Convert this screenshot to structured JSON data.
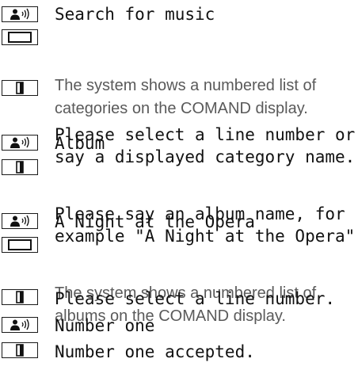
{
  "dialog": [
    {
      "kind": "user",
      "icon": "speaker-voice-icon",
      "lines": [
        "Search for music"
      ]
    },
    {
      "kind": "display",
      "icon": "display-screen-icon",
      "lines": [
        "The system shows a numbered list of",
        "categories on the COMAND display."
      ]
    },
    {
      "kind": "system",
      "icon": "loudspeaker-icon",
      "lines": [
        "Please select a line number or",
        "say a displayed category name."
      ]
    },
    {
      "kind": "user",
      "icon": "speaker-voice-icon",
      "lines": [
        "Album"
      ]
    },
    {
      "kind": "system",
      "icon": "loudspeaker-icon",
      "lines": [
        "Please say an album name, for",
        "example \"A Night at the Opera\"."
      ]
    },
    {
      "kind": "user",
      "icon": "speaker-voice-icon",
      "lines": [
        "A Night at the Opera"
      ]
    },
    {
      "kind": "display",
      "icon": "display-screen-icon",
      "lines": [
        "The system shows a numbered list of",
        "albums on the COMAND display."
      ]
    },
    {
      "kind": "system",
      "icon": "loudspeaker-icon",
      "lines": [
        "Please select a line number."
      ]
    },
    {
      "kind": "user",
      "icon": "speaker-voice-icon",
      "lines": [
        "Number one"
      ]
    },
    {
      "kind": "system",
      "icon": "loudspeaker-icon",
      "lines": [
        "Number one accepted."
      ]
    }
  ]
}
